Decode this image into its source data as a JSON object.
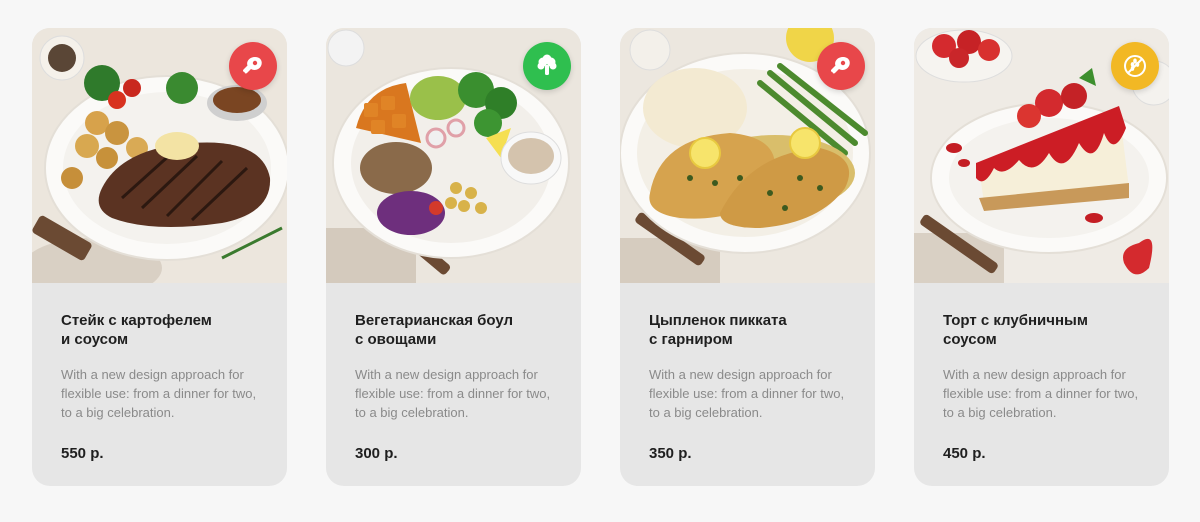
{
  "cards": [
    {
      "title": "Стейк с картофелем\nи соусом",
      "description": "With a new design approach for flexible use: from a dinner for two, to a big celebration.",
      "price": "550 р.",
      "badge": {
        "icon": "meat-icon",
        "color": "#e8474a"
      }
    },
    {
      "title": "Вегетарианская боул\nс овощами",
      "description": "With a new design approach for flexible use: from a dinner for two, to a big celebration.",
      "price": "300 р.",
      "badge": {
        "icon": "broccoli-icon",
        "color": "#2fbf4f"
      }
    },
    {
      "title": "Цыпленок пикката\nс гарниром",
      "description": "With a new design approach for flexible use: from a dinner for two, to a big celebration.",
      "price": "350 р.",
      "badge": {
        "icon": "meat-icon",
        "color": "#e8474a"
      }
    },
    {
      "title": "Торт с клубничным\nсоусом",
      "description": "With a new design approach for flexible use: from a dinner for two, to a big celebration.",
      "price": "450 р.",
      "badge": {
        "icon": "no-gluten-icon",
        "color": "#f2b824"
      }
    }
  ]
}
